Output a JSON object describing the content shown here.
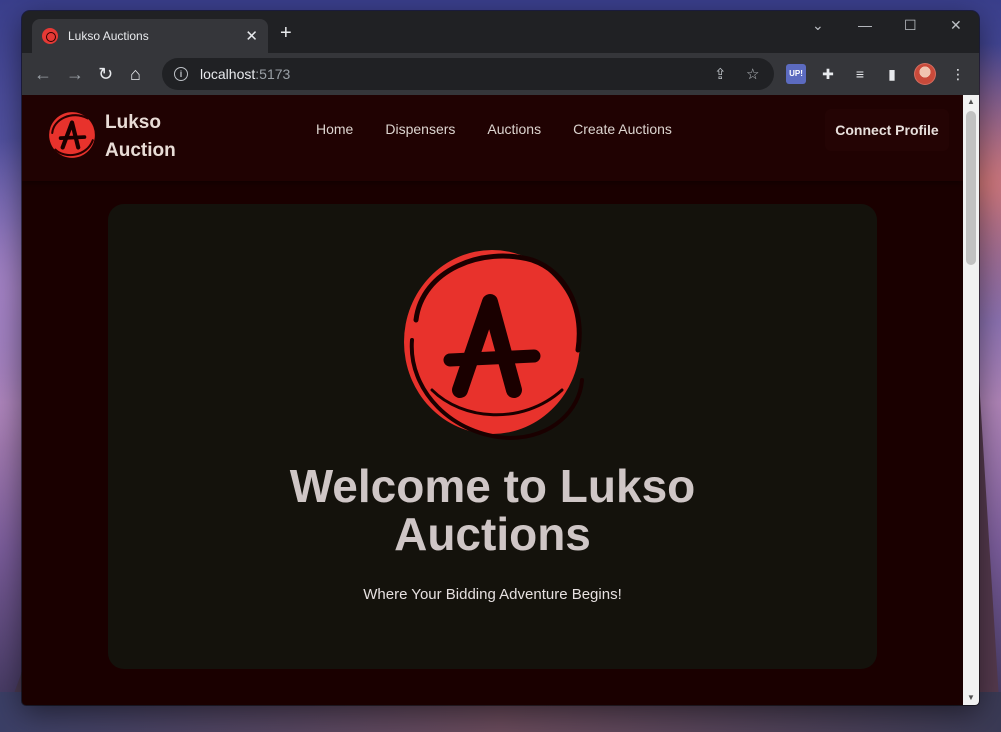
{
  "browser": {
    "tab": {
      "title": "Lukso Auctions",
      "close": "✕"
    },
    "new_tab": "+",
    "window_controls": {
      "tab_search": "⌄",
      "minimize": "—",
      "maximize": "☐",
      "close": "✕"
    },
    "nav": {
      "back": "←",
      "forward": "→",
      "reload": "↻",
      "home": "⌂"
    },
    "address": {
      "host": "localhost",
      "port": ":5173"
    },
    "omnibox_actions": {
      "share": "⇪",
      "bookmark": "☆"
    },
    "extensions": {
      "up": "UP!",
      "puzzle": "✚",
      "media": "≡",
      "sidepanel": "▮",
      "menu": "⋮"
    }
  },
  "site": {
    "brand": {
      "line1": "Lukso",
      "line2": "Auction"
    },
    "nav_links": [
      "Home",
      "Dispensers",
      "Auctions",
      "Create Auctions"
    ],
    "connect_label": "Connect Profile",
    "hero": {
      "title_line1": "Welcome to Lukso",
      "title_line2": "Auctions",
      "subtitle": "Where Your Bidding Adventure Begins!"
    }
  },
  "colors": {
    "brand_red": "#e8322c",
    "page_bg": "#1a0000",
    "hero_bg": "#14120c"
  },
  "icons": {
    "logo": "lukso-auction-logo-icon"
  }
}
